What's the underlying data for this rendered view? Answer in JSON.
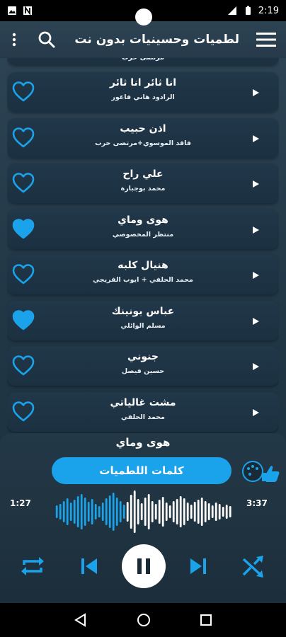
{
  "status_bar": {
    "time": "2:19",
    "icons": [
      "image-icon",
      "n-app-icon",
      "signal-icon",
      "battery-icon"
    ]
  },
  "app_bar": {
    "title": "لطميات وحسينيات بدون نت",
    "icons": [
      "more-vert-icon",
      "search-icon",
      "menu-icon"
    ]
  },
  "partial_item": {
    "artist": "مرتضى حرب"
  },
  "songs": [
    {
      "name": "انا ثائر انا ثائر",
      "artist": "الرادود هاني فاعور",
      "favorite": false
    },
    {
      "name": "اذن حبيب",
      "artist": "فاقد الموسوي+مرتضى حرب",
      "favorite": false
    },
    {
      "name": "علي راح",
      "artist": "محمد بوجبارة",
      "favorite": false
    },
    {
      "name": "هوى وماي",
      "artist": "منتظر المخصوصي",
      "favorite": true
    },
    {
      "name": "هنيال كلبه",
      "artist": "محمد الحلفي + ايوب الفريجي",
      "favorite": false
    },
    {
      "name": "عباس بونينك",
      "artist": "مسلم الوائلي",
      "favorite": true
    },
    {
      "name": "جنوني",
      "artist": "حسين فيصل",
      "favorite": false
    },
    {
      "name": "مشت غالياتي",
      "artist": "محمد الحلفي",
      "favorite": false
    }
  ],
  "player": {
    "now_playing": "هوى وماي",
    "lyrics_button": "كلمات اللطميات",
    "elapsed": "1:27",
    "duration": "3:37",
    "progress": 0.4
  },
  "colors": {
    "accent": "#1aa3ea",
    "heart": "#1aa3ea",
    "row_bg": "#1e3445"
  }
}
